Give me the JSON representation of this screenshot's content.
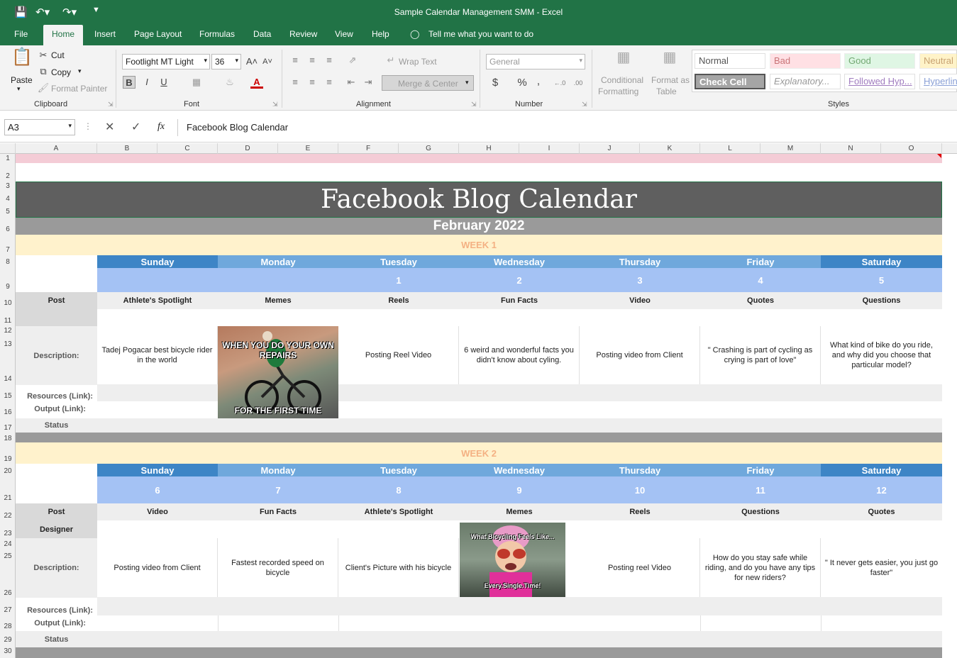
{
  "window": {
    "title": "Sample Calendar Management SMM  -  Excel"
  },
  "menu_tabs": [
    "File",
    "Home",
    "Insert",
    "Page Layout",
    "Formulas",
    "Data",
    "Review",
    "View",
    "Help"
  ],
  "tell_me": "Tell me what you want to do",
  "ribbon": {
    "clipboard": {
      "paste": "Paste",
      "cut": "Cut",
      "copy": "Copy",
      "format_painter": "Format Painter",
      "label": "Clipboard"
    },
    "font": {
      "name": "Footlight MT Light",
      "size": "36",
      "bold": "B",
      "italic": "I",
      "underline": "U",
      "label": "Font"
    },
    "alignment": {
      "wrap": "Wrap Text",
      "merge": "Merge & Center",
      "label": "Alignment"
    },
    "number": {
      "format": "General",
      "label": "Number",
      "currency": "$",
      "percent": "%",
      "comma": ","
    },
    "styles_group": {
      "conditional": "Conditional",
      "conditional2": "Formatting",
      "format_as": "Format as",
      "format_as2": "Table",
      "label": "Styles"
    },
    "styles": {
      "normal": "Normal",
      "bad": "Bad",
      "good": "Good",
      "neutral": "Neutral",
      "check": "Check Cell",
      "explanatory": "Explanatory...",
      "followed": "Followed Hyp...",
      "hyperlink": "Hyperlink"
    }
  },
  "formula_bar": {
    "name_box": "A3",
    "fx": "fx",
    "value": "Facebook Blog Calendar"
  },
  "columns": [
    "A",
    "B",
    "C",
    "D",
    "E",
    "F",
    "G",
    "H",
    "I",
    "J",
    "K",
    "L",
    "M",
    "N",
    "O"
  ],
  "rows": [
    "1",
    "2",
    "3",
    "4",
    "5",
    "6",
    "7",
    "8",
    "9",
    "10",
    "11",
    "12",
    "13",
    "14",
    "15",
    "16",
    "17",
    "18",
    "19",
    "20",
    "21",
    "22",
    "23",
    "24",
    "25",
    "26",
    "27",
    "28",
    "29",
    "30"
  ],
  "sheet": {
    "title": "Facebook Blog Calendar",
    "month": "February 2022",
    "days": [
      "Sunday",
      "Monday",
      "Tuesday",
      "Wednesday",
      "Thursday",
      "Friday",
      "Saturday"
    ],
    "labels": {
      "post": "Post",
      "designer": "Designer",
      "description": "Description:",
      "resources": "Resources (Link):",
      "output": "Output (Link):",
      "status": "Status"
    },
    "week1": {
      "title": "WEEK 1",
      "dates": [
        "",
        "",
        "1",
        "2",
        "3",
        "4",
        "5"
      ],
      "posts": [
        "Athlete's Spotlight",
        "Memes",
        "Reels",
        "Fun Facts",
        "Video",
        "Quotes",
        "Questions"
      ],
      "descriptions": [
        "Tadej Pogacar best bicycle rider in the world",
        "",
        "Posting Reel Video",
        "6 weird and wonderful facts you didn't know about cyling.",
        "Posting video from Client",
        "\" Crashing is part of cycling as crying is part of love\"",
        "What kind of bike do you ride, and why did you choose that particular model?"
      ],
      "meme_top": "WHEN YOU DO YOUR OWN REPAIRS",
      "meme_bottom": "FOR THE FIRST TIME"
    },
    "week2": {
      "title": "WEEK 2",
      "dates": [
        "6",
        "7",
        "8",
        "9",
        "10",
        "11",
        "12"
      ],
      "posts": [
        "Video",
        "Fun Facts",
        "Athlete's Spotlight",
        "Memes",
        "Reels",
        "Questions",
        "Quotes"
      ],
      "descriptions": [
        "Posting video from Client",
        "Fastest recorded speed on bicycle",
        "Client's Picture with his bicycle",
        "",
        "Posting reel Video",
        "How do you stay safe while riding, and do you have any tips for new riders?",
        "\" It never gets easier, you just go faster\""
      ],
      "meme_top": "What Bicycling Feels Like...",
      "meme_bottom": "Every.Single.Time!"
    }
  },
  "colors": {
    "excel_green": "#217346",
    "title_bg": "#5f5f5f",
    "month_bg": "#9a9a9a",
    "week_bg": "#fff2cc",
    "week_text": "#f4b183",
    "day_dark": "#3d85c6",
    "day_light": "#6fa8dc",
    "date_bg": "#a4c2f4"
  }
}
